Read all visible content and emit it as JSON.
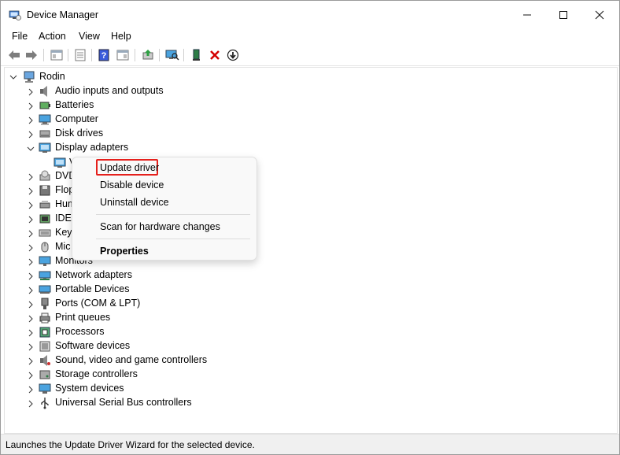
{
  "window": {
    "title": "Device Manager"
  },
  "menu": [
    "File",
    "Action",
    "View",
    "Help"
  ],
  "tree": {
    "root": "Rodin",
    "items": [
      {
        "label": "Audio inputs and outputs",
        "icon": "speaker-icon"
      },
      {
        "label": "Batteries",
        "icon": "battery-icon"
      },
      {
        "label": "Computer",
        "icon": "computer-icon"
      },
      {
        "label": "Disk drives",
        "icon": "disk-icon"
      },
      {
        "label": "Display adapters",
        "icon": "display-adapter-icon",
        "expanded": true
      },
      {
        "label": "DVD",
        "icon": "dvd-icon"
      },
      {
        "label": "Flop",
        "icon": "floppy-icon"
      },
      {
        "label": "Hum",
        "icon": "hid-icon"
      },
      {
        "label": "IDE",
        "icon": "ide-icon"
      },
      {
        "label": "Key",
        "icon": "keyboard-icon"
      },
      {
        "label": "Mic",
        "icon": "mouse-icon"
      },
      {
        "label": "Monitors",
        "icon": "monitor-icon"
      },
      {
        "label": "Network adapters",
        "icon": "network-icon"
      },
      {
        "label": "Portable Devices",
        "icon": "portable-icon"
      },
      {
        "label": "Ports (COM & LPT)",
        "icon": "port-icon"
      },
      {
        "label": "Print queues",
        "icon": "printer-icon"
      },
      {
        "label": "Processors",
        "icon": "processor-icon"
      },
      {
        "label": "Software devices",
        "icon": "software-icon"
      },
      {
        "label": "Sound, video and game controllers",
        "icon": "sound-icon"
      },
      {
        "label": "Storage controllers",
        "icon": "storage-icon"
      },
      {
        "label": "System devices",
        "icon": "system-icon"
      },
      {
        "label": "Universal Serial Bus controllers",
        "icon": "usb-icon"
      }
    ],
    "child_label": "V"
  },
  "context_menu": {
    "update": "Update driver",
    "disable": "Disable device",
    "uninstall": "Uninstall device",
    "scan": "Scan for hardware changes",
    "properties": "Properties"
  },
  "status": "Launches the Update Driver Wizard for the selected device.",
  "colors": {
    "accent": "#e5201c",
    "uninstall": "#d40000"
  }
}
